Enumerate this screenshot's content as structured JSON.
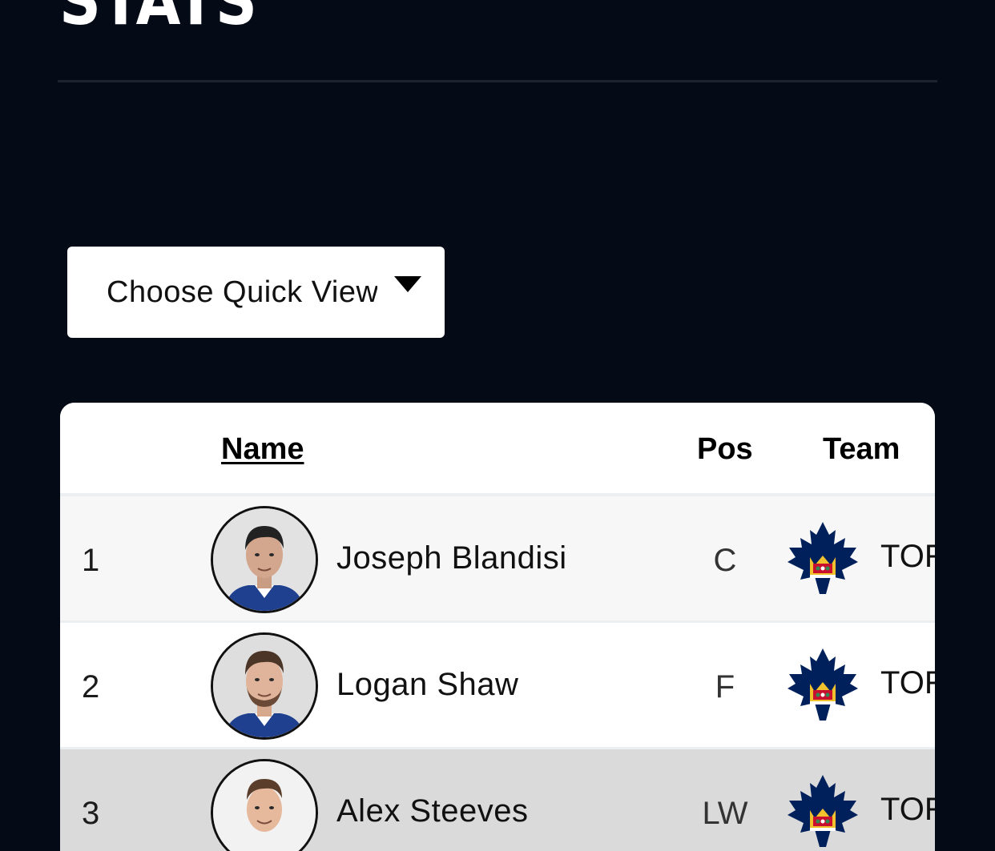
{
  "page": {
    "title": "STATS"
  },
  "quick_view": {
    "label": "Choose Quick View"
  },
  "table": {
    "headers": {
      "name": "Name",
      "pos": "Pos",
      "team": "Team"
    },
    "rows": [
      {
        "rank": "1",
        "name": "Joseph Blandisi",
        "pos": "C",
        "team": "TOR"
      },
      {
        "rank": "2",
        "name": "Logan Shaw",
        "pos": "F",
        "team": "TOR"
      },
      {
        "rank": "3",
        "name": "Alex Steeves",
        "pos": "LW",
        "team": "TOR"
      }
    ]
  },
  "colors": {
    "background": "#050b16",
    "team_blue": "#00205b"
  },
  "icons": {
    "dropdown": "caret-down-icon",
    "team": "maple-leaf-logo-icon"
  }
}
